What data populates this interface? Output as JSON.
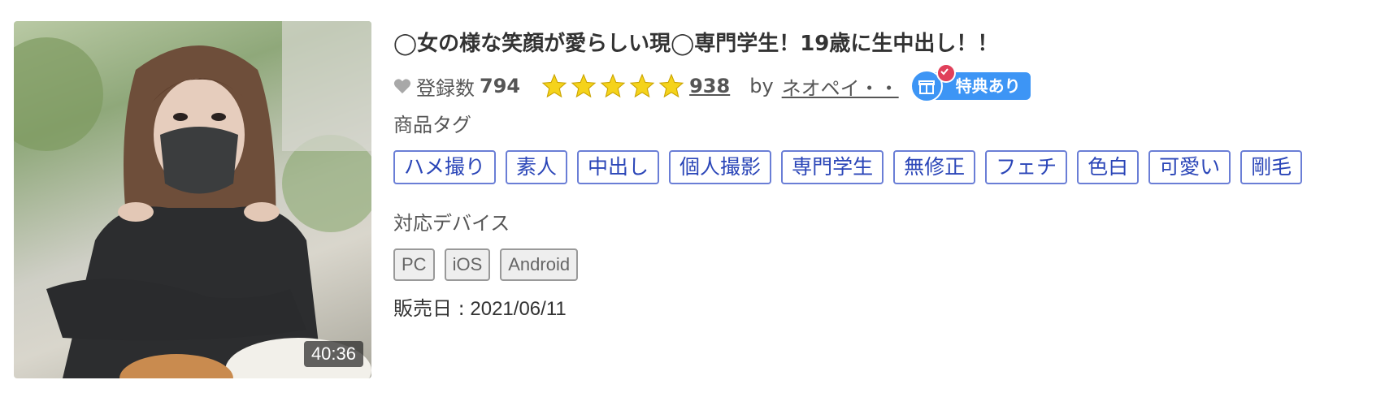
{
  "product": {
    "title": "◯女の様な笑顔が愛らしい現◯専門学生！19歳に生中出し！！",
    "duration": "40:36",
    "favorites_label": "登録数",
    "favorites_count": "794",
    "rating_stars": 5,
    "rating_count": "938",
    "by_label": "by",
    "author": "ネオペイ・・",
    "tokuten_label": "特典あり",
    "tags_heading": "商品タグ",
    "tags": [
      "ハメ撮り",
      "素人",
      "中出し",
      "個人撮影",
      "専門学生",
      "無修正",
      "フェチ",
      "色白",
      "可愛い",
      "剛毛"
    ],
    "devices_heading": "対応デバイス",
    "devices": [
      "PC",
      "iOS",
      "Android"
    ],
    "release_label": "販売日 :",
    "release_date": "2021/06/11"
  },
  "colors": {
    "tag_border": "#6a7ed6",
    "tag_text": "#2b46b8",
    "star": "#f5d31b",
    "tokuten_blue": "#3d95f5",
    "tokuten_badge": "#e0405a"
  },
  "icons": {
    "favorite": "heart-icon",
    "rating": "star-icon",
    "tokuten": "gift-icon"
  }
}
